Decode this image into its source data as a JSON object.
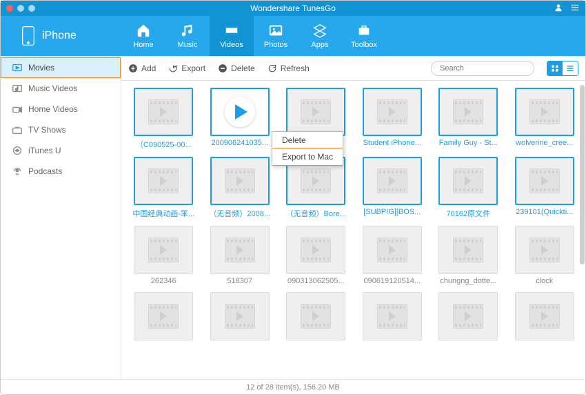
{
  "app_title": "Wondershare TunesGo",
  "device_name": "iPhone",
  "nav": [
    {
      "key": "home",
      "label": "Home"
    },
    {
      "key": "music",
      "label": "Music"
    },
    {
      "key": "videos",
      "label": "Videos"
    },
    {
      "key": "photos",
      "label": "Photos"
    },
    {
      "key": "apps",
      "label": "Apps"
    },
    {
      "key": "toolbox",
      "label": "Toolbox"
    }
  ],
  "nav_active": "videos",
  "sidebar": [
    {
      "key": "movies",
      "label": "Movies",
      "active": true
    },
    {
      "key": "music-videos",
      "label": "Music Videos"
    },
    {
      "key": "home-videos",
      "label": "Home Videos"
    },
    {
      "key": "tv-shows",
      "label": "TV Shows"
    },
    {
      "key": "itunes-u",
      "label": "iTunes U"
    },
    {
      "key": "podcasts",
      "label": "Podcasts"
    }
  ],
  "toolbar": {
    "add": "Add",
    "export": "Export",
    "delete": "Delete",
    "refresh": "Refresh"
  },
  "search_placeholder": "Search",
  "context_menu": {
    "delete": "Delete",
    "export_to_mac": "Export to Mac"
  },
  "grid": [
    {
      "label": "（C090525-00...",
      "selected": true
    },
    {
      "label": "200906241035...",
      "selected": true,
      "playing": true
    },
    {
      "label": "",
      "selected": true
    },
    {
      "label": "Student iPhone...",
      "selected": true
    },
    {
      "label": "Family Guy - St...",
      "selected": true
    },
    {
      "label": "wolverine_cree...",
      "selected": true
    },
    {
      "label": "中国经典动画-笨...",
      "selected": true
    },
    {
      "label": "（无音频）2008...",
      "selected": true
    },
    {
      "label": "（无音频）Bore...",
      "selected": true
    },
    {
      "label": "[SUBPIG][BOS...",
      "selected": true
    },
    {
      "label": "70162原文件",
      "selected": true
    },
    {
      "label": "239101(Quickti...",
      "selected": true
    },
    {
      "label": "262346",
      "selected": false
    },
    {
      "label": "518307",
      "selected": false
    },
    {
      "label": "090313062505...",
      "selected": false
    },
    {
      "label": "090619120514...",
      "selected": false
    },
    {
      "label": "chungng_dotte...",
      "selected": false
    },
    {
      "label": "clock",
      "selected": false
    },
    {
      "label": "",
      "selected": false
    },
    {
      "label": "",
      "selected": false
    },
    {
      "label": "",
      "selected": false
    },
    {
      "label": "",
      "selected": false
    },
    {
      "label": "",
      "selected": false
    },
    {
      "label": "",
      "selected": false
    }
  ],
  "status_text": "12 of 28 item(s), 156.20 MB"
}
